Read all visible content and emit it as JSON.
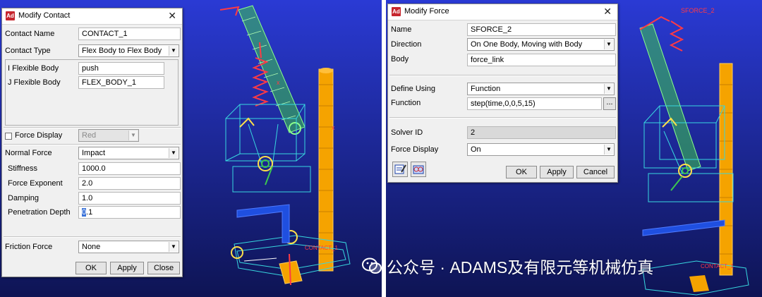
{
  "contact_dialog": {
    "title": "Modify Contact",
    "app_badge": "Ad",
    "close_glyph": "✕",
    "contact_name_label": "Contact Name",
    "contact_name_value": "CONTACT_1",
    "contact_type_label": "Contact Type",
    "contact_type_value": "Flex Body to Flex Body",
    "i_body_label": "I Flexible Body",
    "i_body_value": "push",
    "j_body_label": "J Flexible Body",
    "j_body_value": "FLEX_BODY_1",
    "force_display_label": "Force Display",
    "force_display_value": "Red",
    "normal_force_label": "Normal Force",
    "normal_force_value": "Impact",
    "stiffness_label": "Stiffness",
    "stiffness_value": "1000.0",
    "force_exponent_label": "Force Exponent",
    "force_exponent_value": "2.0",
    "damping_label": "Damping",
    "damping_value": "1.0",
    "penetration_label": "Penetration Depth",
    "penetration_value_selected": "0",
    "penetration_value_rest": ".1",
    "friction_label": "Friction Force",
    "friction_value": "None",
    "ok": "OK",
    "apply": "Apply",
    "close": "Close"
  },
  "force_dialog": {
    "title": "Modify Force",
    "app_badge": "Ad",
    "close_glyph": "✕",
    "name_label": "Name",
    "name_value": "SFORCE_2",
    "direction_label": "Direction",
    "direction_value": "On One Body, Moving with Body",
    "body_label": "Body",
    "body_value": "force_link",
    "define_label": "Define Using",
    "define_value": "Function",
    "function_label": "Function",
    "function_value": "step(time,0,0,5,15)",
    "browse_label": "...",
    "solver_label": "Solver ID",
    "solver_value": "2",
    "force_display_label": "Force Display",
    "force_display_value": "On",
    "ok": "OK",
    "apply": "Apply",
    "cancel": "Cancel"
  },
  "scene_labels": {
    "contact_tag": "CONTACT_1",
    "contact_tag_right": "CONTACT_1",
    "sforce_tag": "SFORCE_2"
  },
  "watermark": {
    "text": "公众号 · ADAMS及有限元等机械仿真"
  },
  "colors": {
    "viewport_top": "#2432c8",
    "viewport_bottom": "#10155a",
    "link_green": "#33c24a",
    "spring_red": "#e8303c",
    "column_orange": "#f5a300",
    "beam_blue": "#1f4fe0",
    "wire_cyan": "#38d7df"
  }
}
